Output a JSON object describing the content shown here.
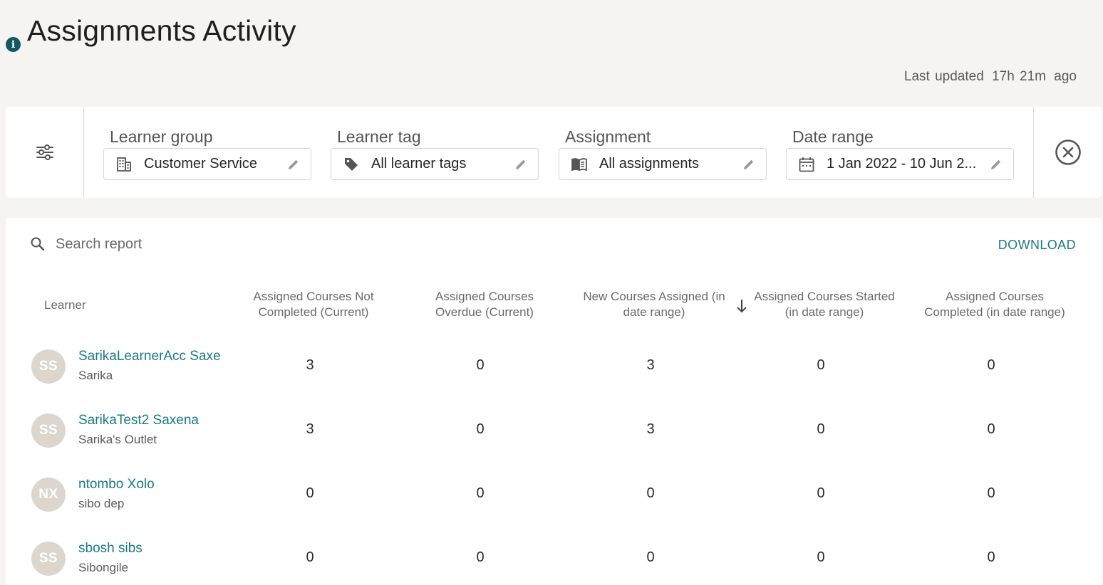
{
  "header": {
    "title": "Assignments Activity",
    "info_icon_glyph": "i",
    "last_updated_label": "Last updated",
    "last_updated_value": "17h 21m",
    "last_updated_suffix": "ago"
  },
  "filters": [
    {
      "label": "Learner group",
      "value": "Customer Service",
      "icon": "building-icon"
    },
    {
      "label": "Learner tag",
      "value": "All learner tags",
      "icon": "tag-icon"
    },
    {
      "label": "Assignment",
      "value": "All assignments",
      "icon": "book-icon"
    },
    {
      "label": "Date range",
      "value": "1 Jan 2022 - 10 Jun 2...",
      "icon": "calendar-icon"
    }
  ],
  "report": {
    "search_placeholder": "Search report",
    "download_label": "DOWNLOAD",
    "columns": {
      "learner": "Learner",
      "not_completed": "Assigned Courses Not Completed (Current)",
      "overdue": "Assigned Courses Overdue (Current)",
      "new_assigned": "New Courses Assigned (in date range)",
      "started": "Assigned Courses Started (in date range)",
      "completed": "Assigned Courses Completed (in date range)"
    },
    "rows": [
      {
        "initials": "SS",
        "name": "SarikaLearnerAcc Saxe",
        "sub": "Sarika",
        "not_completed": "3",
        "overdue": "0",
        "new_assigned": "3",
        "started": "0",
        "completed": "0"
      },
      {
        "initials": "SS",
        "name": "SarikaTest2 Saxena",
        "sub": "Sarika's Outlet",
        "not_completed": "3",
        "overdue": "0",
        "new_assigned": "3",
        "started": "0",
        "completed": "0"
      },
      {
        "initials": "NX",
        "name": "ntombo Xolo",
        "sub": "sibo dep",
        "not_completed": "0",
        "overdue": "0",
        "new_assigned": "0",
        "started": "0",
        "completed": "0"
      },
      {
        "initials": "SS",
        "name": "sbosh sibs",
        "sub": "Sibongile",
        "not_completed": "0",
        "overdue": "0",
        "new_assigned": "0",
        "started": "0",
        "completed": "0"
      }
    ]
  },
  "colors": {
    "accent": "#1a7a86",
    "info_icon": "#0f5a63",
    "avatar_bg": "#dcd6ce",
    "background": "#f5f4f2"
  }
}
